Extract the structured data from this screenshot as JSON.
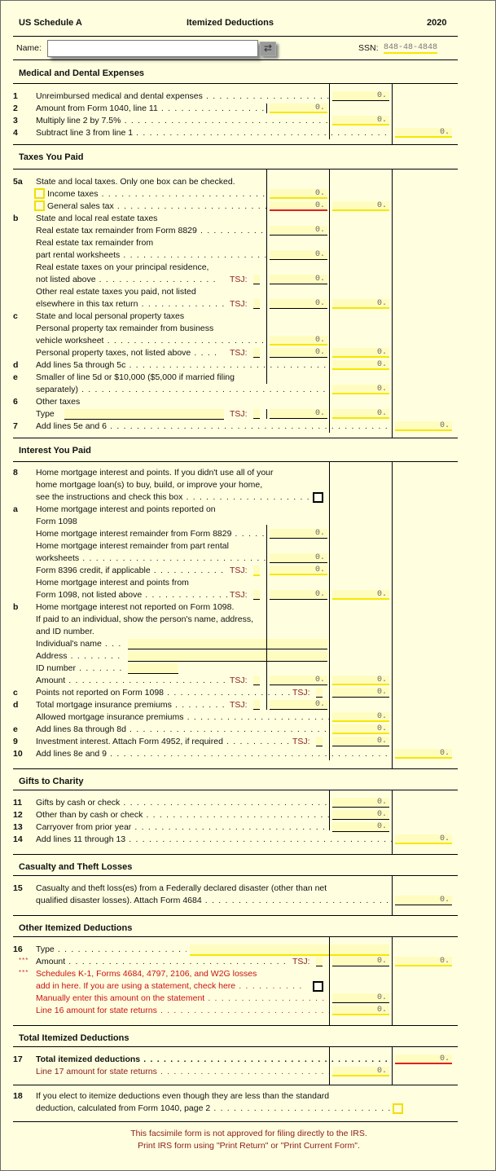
{
  "header": {
    "form": "US Schedule A",
    "title": "Itemized Deductions",
    "year": "2020"
  },
  "name": {
    "label": "Name:",
    "value": "",
    "button_icon": "list-picker-icon"
  },
  "ssn": {
    "label": "SSN:",
    "value": "848-48-4848"
  },
  "sections": {
    "medical": "Medical and Dental Expenses",
    "taxes": "Taxes You Paid",
    "interest": "Interest You Paid",
    "gifts": "Gifts to Charity",
    "casualty": "Casualty and Theft Losses",
    "other": "Other Itemized Deductions",
    "total": "Total Itemized Deductions"
  },
  "tsj_label": "TSJ:",
  "asterisks": "***",
  "rows": [
    {
      "id": "l1",
      "num": "1",
      "text": "Unreimbursed medical and dental expenses",
      "dots": " . . . . . . . . . . . . . . . . . . . . . ",
      "fields": [
        {
          "col": "c2",
          "value": "0.",
          "u": "k"
        }
      ]
    },
    {
      "id": "l2",
      "num": "2",
      "text": "Amount from Form 1040,  line 11",
      "dots": " . . . . . . . . . . . . . . . . . . ",
      "fields": [
        {
          "col": "c1",
          "value": "0.",
          "u": "y"
        }
      ]
    },
    {
      "id": "l3",
      "num": "3",
      "text": "Multiply line 2 by 7.5%",
      "dots": " . . . . . . . . . . . . . . . . . . . . . . . . . . . . . . . ",
      "fields": [
        {
          "col": "c2",
          "value": "0.",
          "u": "y"
        }
      ]
    },
    {
      "id": "l4",
      "num": "4",
      "text": "Subtract line 3 from line 1",
      "dots": " . . . . . . . . . . . . . . . . . . . . . . . . . . . . . . . . . . . . . . . . . . . . . ",
      "fields": [
        {
          "col": "c3",
          "value": "0.",
          "u": "y"
        }
      ]
    },
    {
      "id": "l5a",
      "num": "5a",
      "text": "State and local taxes.  Only one box can be checked.",
      "dots": "",
      "fields": []
    },
    {
      "id": "l5a1",
      "num": "",
      "text": "Income taxes",
      "dots": " . . . . . . . . . . . . . . . . . . . . . . . . . . . . . ",
      "fields": [
        {
          "col": "c1",
          "value": "0.",
          "u": "y"
        }
      ],
      "checkbox": "y"
    },
    {
      "id": "l5a2",
      "num": "",
      "text": "General sales tax",
      "dots": " . . . . . . . . . . . . . . . . . . . . . . . . . . ",
      "fields": [
        {
          "col": "c1",
          "value": "0.",
          "u": "r"
        },
        {
          "col": "c2",
          "value": "0.",
          "u": "y"
        }
      ],
      "checkbox": "y"
    },
    {
      "id": "l5b",
      "num": "b",
      "text": "State and local real estate taxes",
      "dots": "",
      "fields": []
    },
    {
      "id": "l5b1",
      "num": "",
      "text": "Real estate tax remainder from Form 8829",
      "dots": " . . . . . . . . . . . ",
      "fields": [
        {
          "col": "c1",
          "value": "0.",
          "u": "k"
        }
      ]
    },
    {
      "id": "l5b2",
      "num": "",
      "text": "Real estate tax remainder from",
      "dots": "",
      "fields": []
    },
    {
      "id": "l5b3",
      "num": "",
      "text": "part rental worksheets",
      "dots": " . . . . . . . . . . . . . . . . . . . . . . . ",
      "fields": [
        {
          "col": "c1",
          "value": "0.",
          "u": "k"
        }
      ]
    },
    {
      "id": "l5b4",
      "num": "",
      "text": "Real estate taxes on your principal residence,",
      "dots": "",
      "fields": []
    },
    {
      "id": "l5b5",
      "num": "",
      "text": "not listed above",
      "dots": " . . . . . . . . . . . . . . . . . . ",
      "fields": [
        {
          "col": "c1",
          "value": "0.",
          "u": "k"
        }
      ],
      "tsj": "k"
    },
    {
      "id": "l5b6",
      "num": "",
      "text": "Other real estate taxes you paid,  not listed",
      "dots": "",
      "fields": []
    },
    {
      "id": "l5b7",
      "num": "",
      "text": "elsewhere in this tax return",
      "dots": "  . . . . . . . . . . . . . ",
      "fields": [
        {
          "col": "c1",
          "value": "0.",
          "u": "k"
        },
        {
          "col": "c2",
          "value": "0.",
          "u": "y"
        }
      ],
      "tsj": "k"
    },
    {
      "id": "l5c",
      "num": "c",
      "text": "State and local personal property taxes",
      "dots": "",
      "fields": []
    },
    {
      "id": "l5c1",
      "num": "",
      "text": "Personal property tax remainder from business",
      "dots": "",
      "fields": []
    },
    {
      "id": "l5c2",
      "num": "",
      "text": "vehicle worksheet",
      "dots": " . . . . . . . . . . . . . . . . . . . . . . . . . . . . ",
      "fields": [
        {
          "col": "c1",
          "value": "0.",
          "u": "y"
        }
      ]
    },
    {
      "id": "l5c3",
      "num": "",
      "text": "Personal property taxes,  not listed above",
      "dots": " . . . . ",
      "fields": [
        {
          "col": "c1",
          "value": "0.",
          "u": "k"
        },
        {
          "col": "c2",
          "value": "0.",
          "u": "y"
        }
      ],
      "tsj": "k"
    },
    {
      "id": "l5d",
      "num": "d",
      "text": "Add lines 5a through 5c",
      "dots": " . . . . . . . . . . . . . . . . . . . . . . . . . . . . . . . ",
      "fields": [
        {
          "col": "c2",
          "value": "0.",
          "u": "y"
        }
      ]
    },
    {
      "id": "l5e",
      "num": "e",
      "text": "Smaller of line 5d or $10,000  ($5,000 if married filing",
      "dots": "",
      "fields": []
    },
    {
      "id": "l5e1",
      "num": "",
      "text": "separately)",
      "dots": " . . . . . . . . . . . . . . . . . . . . . . . . . . . . . . . . . . . . . . . . ",
      "fields": [
        {
          "col": "c2",
          "value": "0.",
          "u": "y"
        }
      ]
    },
    {
      "id": "l6",
      "num": "6",
      "text": "Other taxes",
      "dots": "",
      "fields": []
    },
    {
      "id": "l6a",
      "num": "",
      "text": "Type",
      "dots": "",
      "fields": [
        {
          "col": "c1",
          "value": "0.",
          "u": "k"
        },
        {
          "col": "c2",
          "value": "0.",
          "u": "y"
        }
      ],
      "tsj": "k",
      "typefield": true
    },
    {
      "id": "l7",
      "num": "7",
      "text": "Add lines 5e and 6",
      "dots": " . . . . . . . . . . . . . . . . . . . . . . . . . . . . . . . . . . . . . . . . . . . . . . . . . . . ",
      "fields": [
        {
          "col": "c3",
          "value": "0.",
          "u": "y"
        }
      ]
    },
    {
      "id": "l8",
      "num": "8",
      "text": "Home mortgage interest and points.  If you didn't use all of your",
      "dots": "",
      "fields": []
    },
    {
      "id": "l8_1",
      "num": "",
      "text": "home mortgage loan(s)  to buy,  build,  or improve your home,",
      "dots": "",
      "fields": []
    },
    {
      "id": "l8_2",
      "num": "",
      "text": "see the instructions and check this box",
      "dots": "  . . . . . . . . . . . . . . . . . . . ",
      "fields": [],
      "rcheckbox": "k"
    },
    {
      "id": "l8a",
      "num": "a",
      "text": "Home mortgage interest and points reported on",
      "dots": "",
      "fields": []
    },
    {
      "id": "l8a1",
      "num": "",
      "text": "Form 1098",
      "dots": "",
      "fields": []
    },
    {
      "id": "l8a2",
      "num": "",
      "text": "Home mortgage interest remainder from Form 8829",
      "dots": " . . . . . ",
      "fields": [
        {
          "col": "c1",
          "value": "0.",
          "u": "k"
        }
      ]
    },
    {
      "id": "l8a3",
      "num": "",
      "text": "Home mortgage interest remainder from part rental",
      "dots": "",
      "fields": []
    },
    {
      "id": "l8a4",
      "num": "",
      "text": "worksheets",
      "dots": " . . . . . . . . . . . . . . . . . . . . . . . . . . . . . . . ",
      "fields": [
        {
          "col": "c1",
          "value": "0.",
          "u": "k"
        }
      ]
    },
    {
      "id": "l8a5",
      "num": "",
      "text": "Form 8396 credit,  if applicable",
      "dots": "  . . . . . . . . . . . ",
      "fields": [
        {
          "col": "c1",
          "value": "0.",
          "u": "y"
        }
      ],
      "tsj": "y"
    },
    {
      "id": "l8a6",
      "num": "",
      "text": "Home mortgage interest and points from",
      "dots": "",
      "fields": []
    },
    {
      "id": "l8a7",
      "num": "",
      "text": "Form 1098,  not listed above",
      "dots": " . . . . . . . . . . . . . ",
      "fields": [
        {
          "col": "c1",
          "value": "0.",
          "u": "k"
        },
        {
          "col": "c2",
          "value": "0.",
          "u": "y"
        }
      ],
      "tsj": "k"
    },
    {
      "id": "l8b",
      "num": "b",
      "text": "Home mortgage interest not reported on Form 1098.",
      "dots": "",
      "fields": []
    },
    {
      "id": "l8b1",
      "num": "",
      "text": "If paid to an individual,  show the person's name,  address,",
      "dots": "",
      "fields": []
    },
    {
      "id": "l8b2",
      "num": "",
      "text": "and ID number.",
      "dots": "",
      "fields": []
    },
    {
      "id": "l8b3",
      "num": "",
      "text": "Individual's name",
      "dots": " . . . ",
      "fields": [],
      "wide": "name"
    },
    {
      "id": "l8b4",
      "num": "",
      "text": "Address",
      "dots": "  . . . . . . . . ",
      "fields": [],
      "wide": "addr"
    },
    {
      "id": "l8b5",
      "num": "",
      "text": "ID number",
      "dots": " . . . . . . . . ",
      "fields": [],
      "wide": "id"
    },
    {
      "id": "l8b6",
      "num": "",
      "text": "Amount",
      "dots": " . . . . . . . . . . . . . . . . . . . . . . . . . . . . . ",
      "fields": [
        {
          "col": "c1",
          "value": "0.",
          "u": "k"
        },
        {
          "col": "c2",
          "value": "0.",
          "u": "y"
        }
      ],
      "tsj": "k"
    },
    {
      "id": "l8c",
      "num": "c",
      "text": "Points not reported on Form 1098",
      "dots": " . . . . . . . . . . . . . . . . . . . . ",
      "fields": [
        {
          "col": "c2",
          "value": "0.",
          "u": "k"
        }
      ],
      "tsj2": "k"
    },
    {
      "id": "l8d",
      "num": "d",
      "text": "Total mortgage insurance premiums",
      "dots": " . . . . . . . . . ",
      "fields": [
        {
          "col": "c1",
          "value": "0.",
          "u": "k"
        }
      ],
      "tsj": "k"
    },
    {
      "id": "l8d1",
      "num": "",
      "text": "Allowed mortgage insurance premiums",
      "dots": " . . . . . . . . . . . . . . . . . . . . . . . . . . ",
      "fields": [
        {
          "col": "c2",
          "value": "0.",
          "u": "y"
        }
      ]
    },
    {
      "id": "l8e",
      "num": "e",
      "text": "Add lines 8a through 8d",
      "dots": " . . . . . . . . . . . . . . . . . . . . . . . . . . . . . . . . ",
      "fields": [
        {
          "col": "c2",
          "value": "0.",
          "u": "y"
        }
      ]
    },
    {
      "id": "l9",
      "num": "9",
      "text": "Investment interest.  Attach Form 4952,  if required",
      "dots": " . . . . . . . . . . ",
      "fields": [
        {
          "col": "c2",
          "value": "0.",
          "u": "k"
        }
      ],
      "tsj2": "k"
    },
    {
      "id": "l10",
      "num": "10",
      "text": "Add lines 8e and 9",
      "dots": " . . . . . . . . . . . . . . . . . . . . . . . . . . . . . . . . . . . . . . . . . . . . . . . . . . . ",
      "fields": [
        {
          "col": "c3",
          "value": "0.",
          "u": "y"
        }
      ]
    },
    {
      "id": "l11",
      "num": "11",
      "text": "Gifts by cash or check",
      "dots": " . . . . . . . . . . . . . . . . . . . . . . . . . . . . . . . . . . . . . . ",
      "fields": [
        {
          "col": "c2",
          "value": "0.",
          "u": "k"
        }
      ]
    },
    {
      "id": "l12",
      "num": "12",
      "text": "Other than by cash or check",
      "dots": " . . . . . . . . . . . . . . . . . . . . . . . . . . . . . . . . . ",
      "fields": [
        {
          "col": "c2",
          "value": "0.",
          "u": "k"
        }
      ]
    },
    {
      "id": "l13",
      "num": "13",
      "text": "Carryover from prior year",
      "dots": " . . . . . . . . . . . . . . . . . . . . . . . . . . . . . . . . . . . ",
      "fields": [
        {
          "col": "c2",
          "value": "0.",
          "u": "k"
        }
      ]
    },
    {
      "id": "l14",
      "num": "14",
      "text": "Add lines 11 through 13",
      "dots": " . . . . . . . . . . . . . . . . . . . . . . . . . . . . . . . . . . . . . . . . . . . . . . . . . ",
      "fields": [
        {
          "col": "c3",
          "value": "0.",
          "u": "y"
        }
      ]
    },
    {
      "id": "l15",
      "num": "15",
      "text": "Casualty and theft loss(es)  from a Federally declared disaster  (other than net",
      "dots": "",
      "fields": []
    },
    {
      "id": "l15a",
      "num": "",
      "text": "qualified disaster losses).  Attach Form 4684",
      "dots": " . . . . . . . . . . . . . . . . . . . . . . . . . . . . ",
      "fields": [
        {
          "col": "c3",
          "value": "0.",
          "u": "k"
        }
      ]
    },
    {
      "id": "l16",
      "num": "16",
      "text": "Type",
      "dots": " . . . . . . . . . . . . . . . . . . . . . . ",
      "fields": [],
      "wide": "type16"
    },
    {
      "id": "l16a",
      "num": "",
      "text": "Amount",
      "dots": " . . . . . . . . . . . . . . . . . . . . . . . . . . . . . . . . . . . . . . ",
      "fields": [
        {
          "col": "c2",
          "value": "0.",
          "u": "k"
        },
        {
          "col": "c3",
          "value": "0.",
          "u": "y"
        }
      ],
      "tsj2": "k",
      "ast": true
    },
    {
      "id": "l16b",
      "num": "",
      "text": "Schedules K-1,  Forms 4684,  4797,  2106,  and W2G losses",
      "dots": "",
      "fields": [],
      "ast": true,
      "red": true
    },
    {
      "id": "l16c",
      "num": "",
      "text": "add in here.  If you are using a statement,  check here",
      "dots": "  . . . . . . . . . . ",
      "fields": [],
      "red": true,
      "rcheckbox": "k"
    },
    {
      "id": "l16d",
      "num": "",
      "text": "Manually enter this amount on the statement",
      "dots": "  . . . . . . . . . . . . . . . . . . . . . ",
      "fields": [
        {
          "col": "c2",
          "value": "0.",
          "u": "k"
        }
      ],
      "red": true
    },
    {
      "id": "l16e",
      "num": "",
      "text": "Line 16 amount for state returns",
      "dots": "  . . . . . . . . . . . . . . . . . . . . . . . . . . . . . ",
      "fields": [
        {
          "col": "c2",
          "value": "0.",
          "u": "y"
        }
      ],
      "red": true
    },
    {
      "id": "l17",
      "num": "17",
      "text": "Total itemized deductions",
      "dots": " . . . . . . . . . . . . . . . . . . . . . . . . . . . . . . . . . . . . . . . ",
      "fields": [
        {
          "col": "c3",
          "value": "0.",
          "u": "r"
        }
      ],
      "bold": true
    },
    {
      "id": "l17a",
      "num": "",
      "text": "Line 17 amount for state returns",
      "dots": "  . . . . . . . . . . . . . . . . . . . . . . . . . . . ",
      "fields": [
        {
          "col": "c2",
          "value": "0.",
          "u": "y"
        }
      ],
      "darkred": true
    },
    {
      "id": "l18",
      "num": "18",
      "text": "If you elect to itemize deductions even though they are less than the standard",
      "dots": "",
      "fields": []
    },
    {
      "id": "l18a",
      "num": "",
      "text": "deduction,  calculated from Form 1040,  page 2",
      "dots": " . . . . . . . . . . . . . . . . . . . . . . . . . . . . . . . . . . . . . . . ",
      "fields": [],
      "farcheckbox": "y"
    }
  ],
  "footer": {
    "line1": "This facsimile form is not approved for filing directly to the IRS.",
    "line2": "Print IRS form using \"Print Return\" or \"Print Current Form\"."
  }
}
